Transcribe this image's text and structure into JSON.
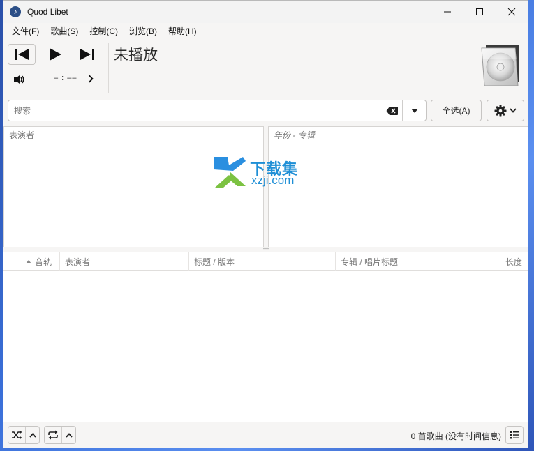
{
  "window": {
    "title": "Quod Libet"
  },
  "menubar": {
    "items": [
      "文件(F)",
      "歌曲(S)",
      "控制(C)",
      "浏览(B)",
      "帮助(H)"
    ]
  },
  "player": {
    "now_playing": "未播放",
    "time": "– : ––",
    "icons": {
      "prev": "skip-previous-icon",
      "play": "play-icon",
      "next": "skip-next-icon",
      "volume": "volume-icon",
      "cover": "cd-case-icon"
    }
  },
  "search": {
    "placeholder": "搜索",
    "select_all_label": "全选(A)"
  },
  "panes": {
    "left_header": "表演者",
    "right_header": "年份 - 专辑"
  },
  "watermark": {
    "cn": "下载集",
    "en": "xzji.com"
  },
  "songlist": {
    "columns": [
      "",
      "音轨",
      "表演者",
      "标题 / 版本",
      "专辑 / 唱片标题",
      "长度"
    ]
  },
  "statusbar": {
    "text": "0 首歌曲 (没有时间信息)"
  },
  "colors": {
    "accent": "#1f8fd6",
    "window_bg": "#f6f5f4",
    "desktop": "#3a6fd8"
  }
}
